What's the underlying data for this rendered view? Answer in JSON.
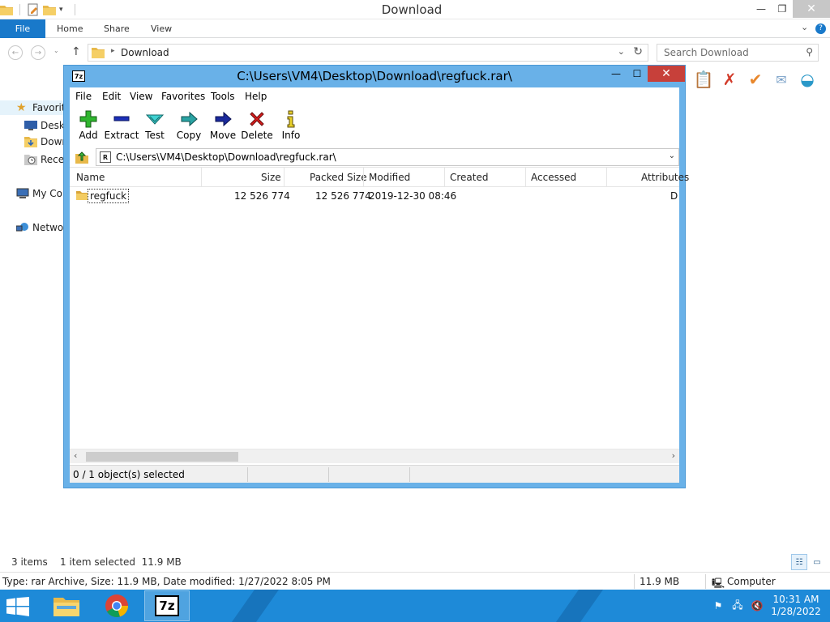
{
  "explorer": {
    "title": "Download",
    "ribbon_tabs": {
      "file": "File",
      "home": "Home",
      "share": "Share",
      "view": "View"
    },
    "address": {
      "crumb": "Download"
    },
    "search": {
      "placeholder": "Search Download"
    },
    "nav": {
      "favorites": "Favorites",
      "desktop": "Desktop",
      "downloads": "Downloads",
      "recent": "Recent places",
      "mycomputer": "My Computer",
      "network": "Network"
    },
    "status": {
      "items": "3 items",
      "selected": "1 item selected  11.9 MB"
    },
    "details": {
      "type_info": "Type: rar Archive, Size: 11.9 MB, Date modified: 1/27/2022 8:05 PM",
      "size": "11.9 MB",
      "location": "Computer"
    }
  },
  "sevenzip": {
    "title": "C:\\Users\\VM4\\Desktop\\Download\\regfuck.rar\\",
    "menu": [
      "File",
      "Edit",
      "View",
      "Favorites",
      "Tools",
      "Help"
    ],
    "toolbar": [
      "Add",
      "Extract",
      "Test",
      "Copy",
      "Move",
      "Delete",
      "Info"
    ],
    "path": "C:\\Users\\VM4\\Desktop\\Download\\regfuck.rar\\",
    "columns": [
      "Name",
      "Size",
      "Packed Size",
      "Modified",
      "Created",
      "Accessed",
      "Attributes"
    ],
    "rows": [
      {
        "name": "regfuck",
        "size": "12 526 774",
        "packed": "12 526 774",
        "modified": "2019-12-30 08:46",
        "created": "",
        "accessed": "",
        "attributes": "D"
      }
    ],
    "status": "0 / 1 object(s) selected"
  },
  "taskbar": {
    "apps": [
      "File Explorer",
      "Google Chrome",
      "7-Zip File Manager"
    ],
    "clock": {
      "time": "10:31 AM",
      "date": "1/28/2022"
    }
  },
  "colors": {
    "accent": "#1979ca",
    "taskbar": "#1e8ad8",
    "sevenzip_frame": "#69b1e8",
    "close_red": "#c7403a"
  }
}
